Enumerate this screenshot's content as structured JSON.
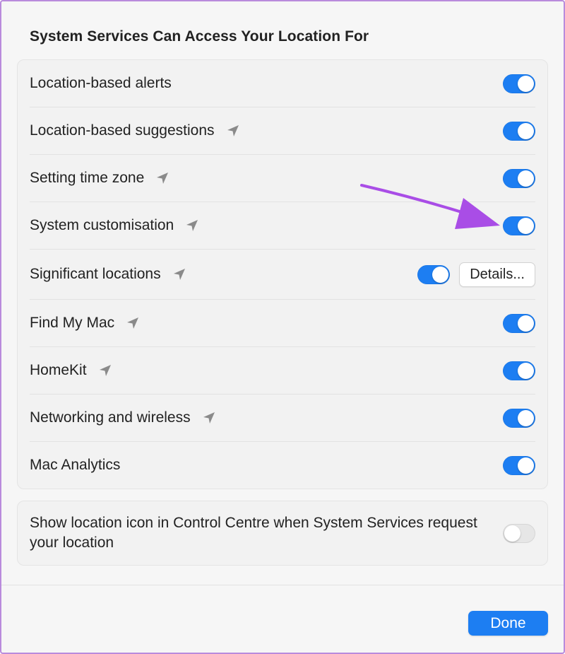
{
  "section": {
    "title": "System Services Can Access Your Location For"
  },
  "services": [
    {
      "label": "Location-based alerts",
      "has_location_icon": false,
      "enabled": true
    },
    {
      "label": "Location-based suggestions",
      "has_location_icon": true,
      "enabled": true
    },
    {
      "label": "Setting time zone",
      "has_location_icon": true,
      "enabled": true
    },
    {
      "label": "System customisation",
      "has_location_icon": true,
      "enabled": true
    },
    {
      "label": "Significant locations",
      "has_location_icon": true,
      "enabled": true,
      "details_label": "Details..."
    },
    {
      "label": "Find My Mac",
      "has_location_icon": true,
      "enabled": true
    },
    {
      "label": "HomeKit",
      "has_location_icon": true,
      "enabled": true
    },
    {
      "label": "Networking and wireless",
      "has_location_icon": true,
      "enabled": true
    },
    {
      "label": "Mac Analytics",
      "has_location_icon": false,
      "enabled": true
    }
  ],
  "control_centre": {
    "label": "Show location icon in Control Centre when System Services request your location",
    "enabled": false
  },
  "footer": {
    "done_label": "Done"
  },
  "colors": {
    "accent": "#1d7ef2",
    "annotation_arrow": "#a94de6",
    "location_icon": "#8a8a8a"
  },
  "icons": {
    "location": "location-arrow-icon"
  }
}
